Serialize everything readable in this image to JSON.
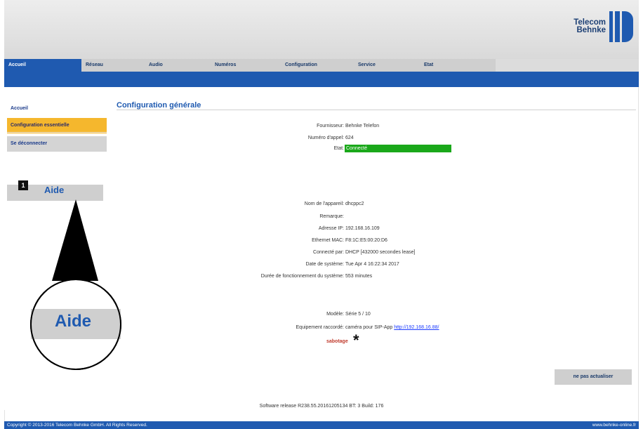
{
  "header": {
    "logo_line1": "Telecom",
    "logo_line2": "Behnke"
  },
  "tabs": [
    "Accueil",
    "Réseau",
    "Audio",
    "Numéros",
    "Configuration",
    "Service",
    "Etat"
  ],
  "sidebar": {
    "home": "Accueil",
    "config": "Configuration essentielle",
    "logout": "Se déconnecter",
    "help": "Aide"
  },
  "callout": {
    "number": "1",
    "zoom_label": "Aide"
  },
  "main": {
    "title": "Configuration générale",
    "provider_label": "Fournisseur:",
    "provider_value": "Behnke Telefon",
    "phone_label": "Numéro d'appel:",
    "phone_value": "624",
    "state_label": "Etat:",
    "state_value": "Connecté",
    "device_label": "Nom de l'appareil:",
    "device_value": "dhcppc2",
    "remark_label": "Remarque:",
    "ip_label": "Adresse IP:",
    "ip_value": "192.168.16.109",
    "mac_label": "Ethernet MAC:",
    "mac_value": "F8:1C:E5:00:20:D6",
    "connected_label": "Connecté par:",
    "connected_value": "DHCP  [432000 secondes lease]",
    "date_label": "Date de système:",
    "date_value": "Tue Apr 4 16:22:34 2017",
    "uptime_label": "Durée de fonctionnement du système:",
    "uptime_value": "553 minutes",
    "model_label": "Modèle:",
    "model_value": "Série 5 / 10",
    "equip_label": "Equipement raccordé:",
    "equip_value": "caméra pour SIP-App",
    "equip_link": "http://192.168.16.88/",
    "sabotage": "sabotage",
    "star": "*"
  },
  "refresh_button": "ne pas actualiser",
  "software": "Software release R238.55.20161205134 BT: 3 Build: 176",
  "footer": {
    "copyright": "Copyright © 2013-2016 Telecom Behnke GmbH. All Rights Reserved.",
    "link": "www.behnke-online.fr"
  },
  "colors": {
    "brand_blue": "#1f5ab0",
    "orange": "#f5b72d",
    "green": "#1aa81a"
  }
}
